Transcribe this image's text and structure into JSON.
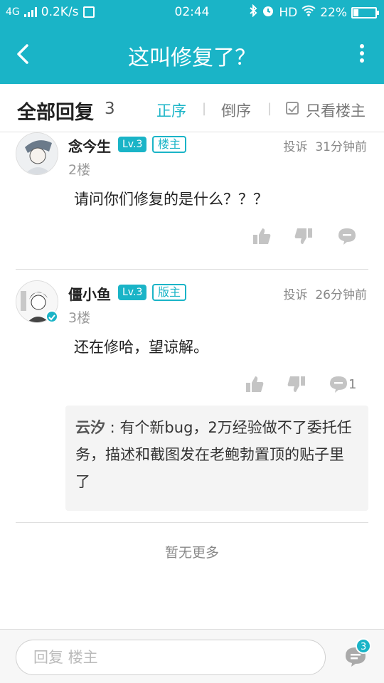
{
  "status_bar": {
    "network": "4G",
    "speed": "0.2K/s",
    "time": "02:44",
    "hd": "HD",
    "battery_percent": "22%",
    "battery_level": 0.22
  },
  "app_bar": {
    "title": "这叫修复了？"
  },
  "sort_bar": {
    "label": "全部回复",
    "count": "3",
    "order_asc": "正序",
    "order_desc": "倒序",
    "only_owner": "只看楼主"
  },
  "posts": [
    {
      "username": "念今生",
      "level": "Lv.3",
      "role": "楼主",
      "report": "投诉",
      "time": "31分钟前",
      "floor": "2楼",
      "content": "请问你们修复的是什么？？？"
    },
    {
      "username": "僵小鱼",
      "level": "Lv.3",
      "role": "版主",
      "report": "投诉",
      "time": "26分钟前",
      "floor": "3楼",
      "content": "还在修哈，望谅解。",
      "reply_count": "1",
      "sub_reply": {
        "author": "云汐",
        "text": "有个新bug，2万经验做不了委托任务，描述和截图发在老鲍勃置顶的贴子里了"
      }
    }
  ],
  "no_more": "暂无更多",
  "bottom_bar": {
    "reply_placeholder": "回复 楼主",
    "message_badge": "3"
  },
  "colors": {
    "accent": "#1ab4c7",
    "icon_gray": "#c4c4c4"
  }
}
